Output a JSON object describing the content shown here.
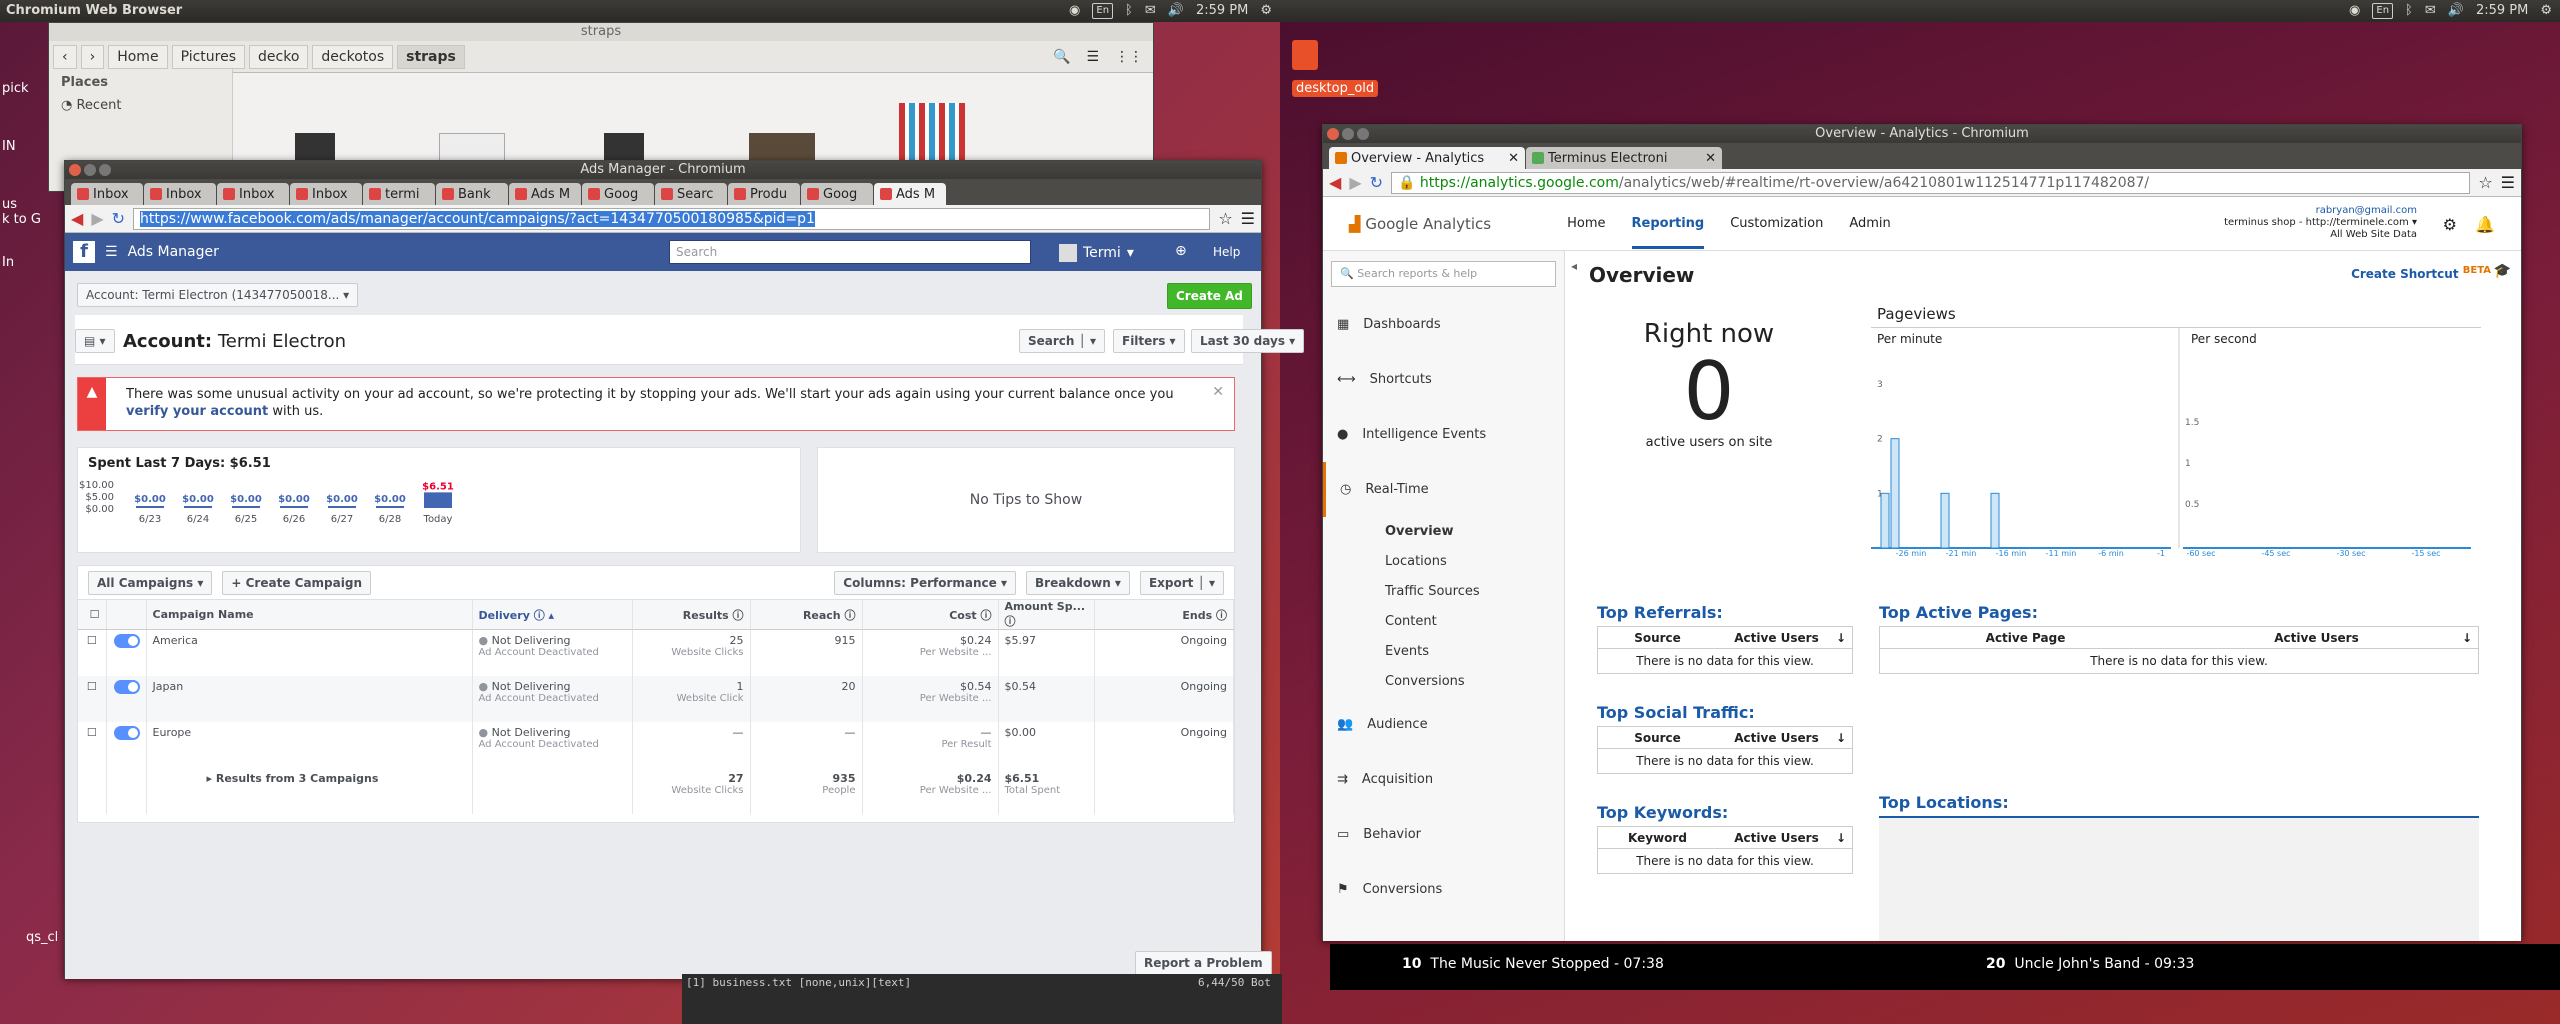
{
  "left_panel": {
    "app_title": "Chromium Web Browser",
    "tray": {
      "lang": "En",
      "time": "2:59 PM"
    }
  },
  "right_panel": {
    "tray": {
      "lang": "En",
      "time": "2:59 PM"
    },
    "desktop_icon_label": "desktop_old"
  },
  "desktop_icons_left": [
    "pick",
    "IN",
    "us",
    "In",
    "qs_cl",
    "k to G"
  ],
  "nautilus": {
    "title": "straps",
    "breadcrumbs": [
      "Home",
      "Pictures",
      "decko",
      "deckotos",
      "straps"
    ],
    "places_header": "Places",
    "places": [
      "Recent"
    ]
  },
  "fb_window": {
    "title": "Ads Manager - Chromium",
    "tabs": [
      "Inbox",
      "Inbox",
      "Inbox",
      "Inbox",
      "termi",
      "Bank",
      "Ads M",
      "Goog",
      "Searc",
      "Produ",
      "Goog",
      "Ads M"
    ],
    "url": "https://www.facebook.com/ads/manager/account/campaigns/?act=1434770500180985&pid=p1",
    "header": {
      "app_name": "Ads Manager",
      "search_placeholder": "Search",
      "user": "Termi",
      "help": "Help"
    },
    "account_selector": "Account: Termi Electron (143477050018...",
    "create_ad": "Create Ad",
    "account_label": "Account:",
    "account_name": "Termi Electron",
    "filters": {
      "search": "Search",
      "filters": "Filters",
      "range": "Last 30 days"
    },
    "alert": {
      "text": "There was some unusual activity on your ad account, so we're protecting it by stopping your ads. We'll start your ads again using your current balance once you",
      "link": "verify your account",
      "tail": "with us."
    },
    "spend": {
      "title": "Spent Last 7 Days: $6.51",
      "yticks": [
        "$10.00",
        "$5.00",
        "$0.00"
      ]
    },
    "tips": "No Tips to Show",
    "toolbar": {
      "all": "All Campaigns",
      "create": "Create Campaign",
      "columns": "Columns: Performance",
      "breakdown": "Breakdown",
      "export": "Export"
    },
    "columns": [
      "Campaign Name",
      "Delivery",
      "Results",
      "Reach",
      "Cost",
      "Amount Sp...",
      "Ends"
    ],
    "rows": [
      {
        "name": "America",
        "delivery": "Not Delivering",
        "delivery_sub": "Ad Account Deactivated",
        "results": "25",
        "results_sub": "Website Clicks",
        "reach": "915",
        "cost": "$0.24",
        "cost_sub": "Per Website ...",
        "amount": "$5.97",
        "ends": "Ongoing"
      },
      {
        "name": "Japan",
        "delivery": "Not Delivering",
        "delivery_sub": "Ad Account Deactivated",
        "results": "1",
        "results_sub": "Website Click",
        "reach": "20",
        "cost": "$0.54",
        "cost_sub": "Per Website ...",
        "amount": "$0.54",
        "ends": "Ongoing"
      },
      {
        "name": "Europe",
        "delivery": "Not Delivering",
        "delivery_sub": "Ad Account Deactivated",
        "results": "—",
        "results_sub": "",
        "reach": "—",
        "cost": "—",
        "cost_sub": "Per Result",
        "amount": "$0.00",
        "ends": "Ongoing"
      }
    ],
    "totals": {
      "label": "Results from 3 Campaigns",
      "results": "27",
      "results_sub": "Website Clicks",
      "reach": "935",
      "reach_sub": "People",
      "cost": "$0.24",
      "cost_sub": "Per Website ...",
      "amount": "$6.51",
      "amount_sub": "Total Spent"
    },
    "report": "Report a Problem"
  },
  "ga_window": {
    "title": "Overview - Analytics - Chromium",
    "tabs": [
      "Overview - Analytics",
      "Terminus Electroni"
    ],
    "url_host": "https://analytics.google.com",
    "url_path": "/analytics/web/#realtime/rt-overview/a64210801w112514771p117482087/",
    "logo": "Google Analytics",
    "nav": [
      "Home",
      "Reporting",
      "Customization",
      "Admin"
    ],
    "account": {
      "email": "rabryan@gmail.com",
      "property": "terminus shop - http://terminele.com",
      "view": "All Web Site Data"
    },
    "search_placeholder": "Search reports & help",
    "sidebar": [
      "Dashboards",
      "Shortcuts",
      "Intelligence Events",
      "Real-Time",
      "Audience",
      "Acquisition",
      "Behavior",
      "Conversions"
    ],
    "realtime_sub": [
      "Overview",
      "Locations",
      "Traffic Sources",
      "Content",
      "Events",
      "Conversions"
    ],
    "page_title": "Overview",
    "create_shortcut": "Create Shortcut",
    "beta": "BETA",
    "right_now": "Right now",
    "active_count": "0",
    "active_label": "active users on site",
    "pageviews": "Pageviews",
    "per_minute": "Per minute",
    "per_second": "Per second",
    "top_referrals": "Top Referrals:",
    "top_social": "Top Social Traffic:",
    "top_keywords": "Top Keywords:",
    "top_pages": "Top Active Pages:",
    "top_locations": "Top Locations:",
    "col_source": "Source",
    "col_active": "Active Users",
    "col_keyword": "Keyword",
    "col_page": "Active Page",
    "no_data": "There is no data for this view."
  },
  "media": {
    "track1_num": "10",
    "track1": "The Music Never Stopped - 07:38",
    "track2_num": "20",
    "track2": "Uncle John's Band - 09:33"
  },
  "terminal": {
    "status": "[1] business.txt [none,unix][text]",
    "pos": "6,44/50 Bot"
  },
  "chart_data": {
    "type": "bar",
    "title": "Spent Last 7 Days: $6.51",
    "categories": [
      "6/23",
      "6/24",
      "6/25",
      "6/26",
      "6/27",
      "6/28",
      "Today"
    ],
    "values": [
      0.0,
      0.0,
      0.0,
      0.0,
      0.0,
      0.0,
      6.51
    ],
    "labels": [
      "$0.00",
      "$0.00",
      "$0.00",
      "$0.00",
      "$0.00",
      "$0.00",
      "$6.51"
    ],
    "ylim": [
      0,
      10
    ],
    "color": "#4267b2"
  },
  "pageviews_chart": {
    "type": "bar",
    "title": "Pageviews",
    "ylim": [
      0,
      3
    ],
    "yticks": [
      "3",
      "2",
      "1"
    ],
    "xticks": [
      "-26 min",
      "-21 min",
      "-16 min",
      "-11 min",
      "-6 min",
      "-1"
    ],
    "minutes_ago": [
      29,
      28,
      23,
      18
    ],
    "values": [
      1,
      2,
      1,
      1
    ],
    "per_second_yticks": [
      "1.5",
      "1",
      "0.5"
    ],
    "per_second_xticks": [
      "-60 sec",
      "-45 sec",
      "-30 sec",
      "-15 sec"
    ]
  }
}
